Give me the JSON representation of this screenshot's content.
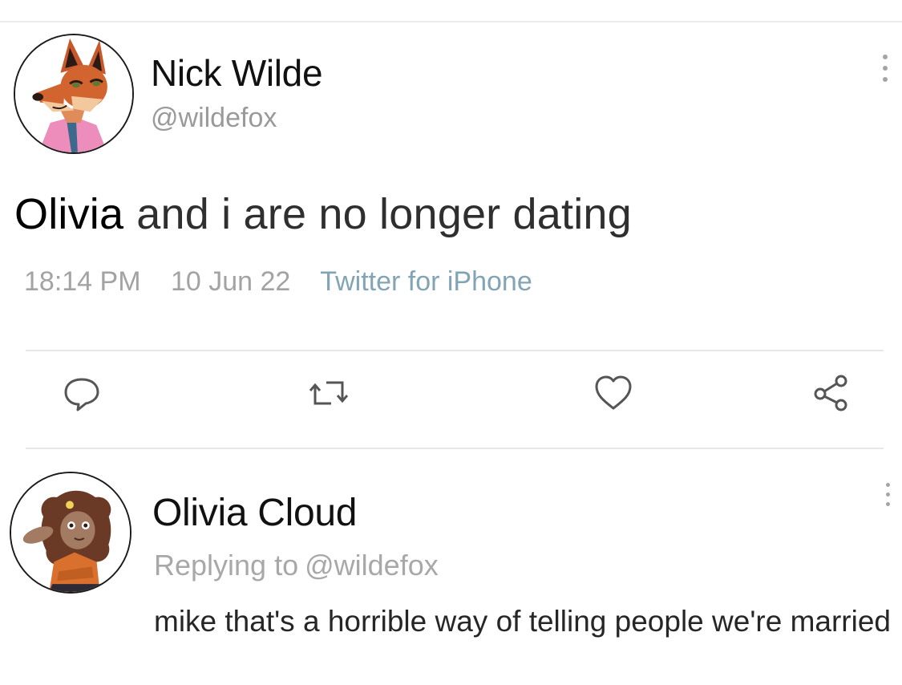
{
  "tweet": {
    "author_name": "Nick Wilde",
    "author_handle": "@wildefox",
    "text_mention": "Olivia",
    "text_rest": "and i are no longer dating",
    "time": "18:14 PM",
    "date": "10 Jun 22",
    "source": "Twitter for iPhone",
    "avatar_icon": "fox-avatar",
    "more_icon": "vertical-dots-icon"
  },
  "actions": [
    {
      "icon": "reply-icon"
    },
    {
      "icon": "retweet-icon"
    },
    {
      "icon": "like-icon"
    },
    {
      "icon": "share-icon"
    }
  ],
  "reply": {
    "author_name": "Olivia Cloud",
    "replying_label": "Replying to",
    "replying_handle": "@wildefox",
    "text": "mike that's a horrible way of telling people we're married",
    "avatar_icon": "bunny-avatar"
  },
  "colors": {
    "handle_gray": "#9a9a9a",
    "source_blue": "#82a4b4",
    "divider": "#e7e7e7"
  }
}
